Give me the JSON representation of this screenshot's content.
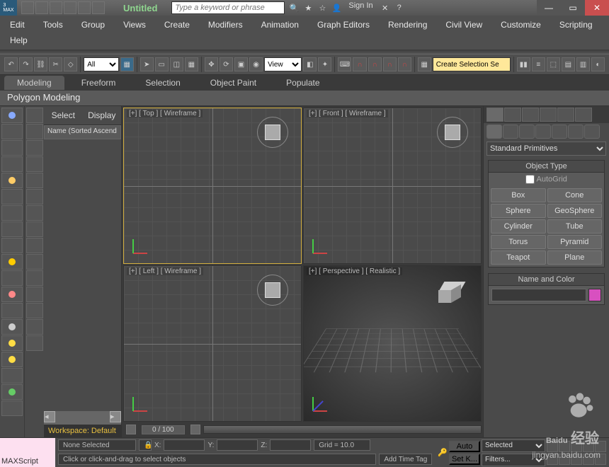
{
  "title": "Untitled",
  "search_placeholder": "Type a keyword or phrase",
  "signin": "Sign In",
  "menu": [
    "Edit",
    "Tools",
    "Group",
    "Views",
    "Create",
    "Modifiers",
    "Animation",
    "Graph Editors",
    "Rendering",
    "Civil View",
    "Customize",
    "Scripting"
  ],
  "menu2": [
    "Help"
  ],
  "toolbar": {
    "filter": "All",
    "view": "View",
    "create_selection": "Create Selection Se"
  },
  "ribbon": {
    "tabs": [
      "Modeling",
      "Freeform",
      "Selection",
      "Object Paint",
      "Populate"
    ],
    "sub": "Polygon Modeling"
  },
  "scene": {
    "tabs": [
      "Select",
      "Display"
    ],
    "header": "Name (Sorted Ascend",
    "workspace": "Workspace: Default"
  },
  "viewports": {
    "top": "[+] [ Top ] [ Wireframe ]",
    "front": "[+] [ Front ] [ Wireframe ]",
    "left": "[+] [ Left ] [ Wireframe ]",
    "persp": "[+] [ Perspective ] [ Realistic ]"
  },
  "timeline": {
    "frame": "0 / 100"
  },
  "cmdpanel": {
    "dropdown": "Standard Primitives",
    "object_type": "Object Type",
    "autogrid": "AutoGrid",
    "buttons": [
      "Box",
      "Cone",
      "Sphere",
      "GeoSphere",
      "Cylinder",
      "Tube",
      "Torus",
      "Pyramid",
      "Teapot",
      "Plane"
    ],
    "name_color": "Name and Color",
    "swatch": "#d850c0"
  },
  "status": {
    "none_selected": "None Selected",
    "x": "X:",
    "y": "Y:",
    "z": "Z:",
    "grid": "Grid = 10.0",
    "hint": "Click or click-and-drag to select objects",
    "add_time_tag": "Add Time Tag",
    "maxscript": "MAXScript",
    "auto": "Auto",
    "setk": "Set K...",
    "selected": "Selected",
    "filters": "Filters..."
  },
  "watermark": {
    "brand": "Baidu",
    "cn": "经验",
    "url": "jingyan.baidu.com"
  }
}
